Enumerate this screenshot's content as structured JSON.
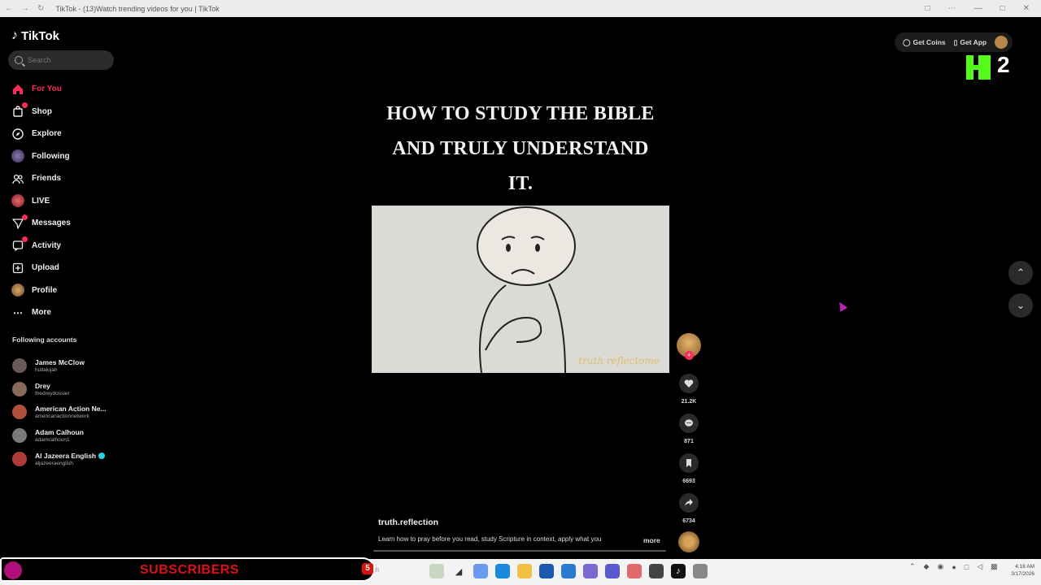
{
  "browser": {
    "tab_title": "TikTok - (13)Watch trending videos for you | TikTok"
  },
  "sidebar": {
    "logo": "TikTok",
    "search_placeholder": "Search",
    "nav": [
      {
        "label": "For You",
        "icon": "home-icon"
      },
      {
        "label": "Shop",
        "icon": "shopping-bag-icon"
      },
      {
        "label": "Explore",
        "icon": "compass-icon"
      },
      {
        "label": "Following",
        "icon": "following-avatar-icon"
      },
      {
        "label": "Friends",
        "icon": "friends-icon"
      },
      {
        "label": "LIVE",
        "icon": "live-icon"
      },
      {
        "label": "Messages",
        "icon": "messages-icon"
      },
      {
        "label": "Activity",
        "icon": "activity-icon"
      },
      {
        "label": "Upload",
        "icon": "upload-icon"
      },
      {
        "label": "Profile",
        "icon": "profile-avatar-icon"
      },
      {
        "label": "More",
        "icon": "more-dots-icon"
      }
    ],
    "following_title": "Following accounts",
    "following": [
      {
        "name": "James McClow",
        "handle": "hullalujah"
      },
      {
        "name": "Drey",
        "handle": "thedreydossier"
      },
      {
        "name": "American Action Ne...",
        "handle": "americanactionnetwork"
      },
      {
        "name": "Adam Calhoun",
        "handle": "adamcalhoun1"
      },
      {
        "name": "Al Jazeera English",
        "handle": "aljazeeraenglish"
      }
    ]
  },
  "video": {
    "title_lines": [
      "HOW TO STUDY THE BIBLE",
      "AND TRULY UNDERSTAND",
      "IT."
    ],
    "watermark": "truth reflectome",
    "creator": "truth.reflection",
    "caption": "Learn how to pray before you read, study Scripture in context, apply what you",
    "more_label": "more"
  },
  "actions": {
    "likes": "21.2K",
    "comments": "871",
    "saves": "6693",
    "shares": "6734"
  },
  "top_right": {
    "get_coins": "Get Coins",
    "get_app": "Get App"
  },
  "overlay": {
    "kick_count": "2",
    "subscribers_label": "SUBSCRIBERS",
    "subscribers_count": "5"
  },
  "taskbar": {
    "search_hint": "rch",
    "time": "4:18 AM",
    "date": "3/17/2026"
  },
  "colors": {
    "accent": "#fe2c55",
    "kick_green": "#53fc18"
  }
}
